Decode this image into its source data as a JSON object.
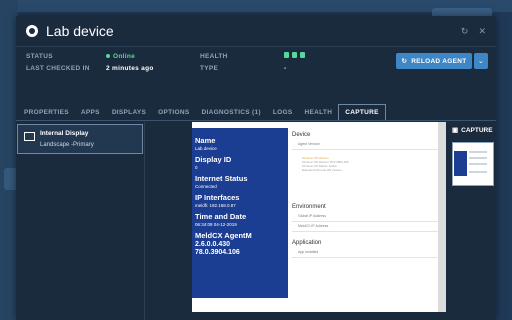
{
  "header": {
    "title": "Lab device"
  },
  "status": {
    "status_label": "STATUS",
    "status_value": "Online",
    "checked_label": "LAST CHECKED IN",
    "checked_value": "2 minutes ago",
    "health_label": "HEALTH",
    "type_label": "TYPE",
    "type_value": "-"
  },
  "actions": {
    "reload_label": "RELOAD AGENT"
  },
  "tabs": [
    "PROPERTIES",
    "APPS",
    "DISPLAYS",
    "OPTIONS",
    "DIAGNOSTICS (1)",
    "LOGS",
    "HEALTH",
    "CAPTURE"
  ],
  "display": {
    "name": "Internal Display",
    "orientation": "Landscape -Primary"
  },
  "preview": {
    "name_label": "Name",
    "name_value": "Lab device",
    "display_label": "Display ID",
    "display_value": "0",
    "internet_label": "Internet Status",
    "internet_value": "Connected",
    "ip_label": "IP Interfaces",
    "ip_value": "meldfi: 192.168.0.87",
    "time_label": "Time and Date",
    "time_value": "06:34:08 04-12-2019",
    "agent_label": "MeldCX AgentM",
    "agent_v1": "2.6.0.0.430",
    "agent_v2": "78.0.3904.106",
    "sec_device": "Device",
    "row_agent": "Agent Version",
    "row_check1": "Chrome OS Version",
    "row_check2": "Chrome OS Version 78.0.3904.106",
    "row_check3": "Chrome OS Status: Active",
    "row_check4": "Expected Chrome OS version",
    "sec_env": "Environment",
    "row_global": "Global IP Address",
    "row_meld": "MeldCX IP Address",
    "sec_app": "Application",
    "row_app": "App Installed"
  },
  "capture": {
    "label": "CAPTURE"
  }
}
